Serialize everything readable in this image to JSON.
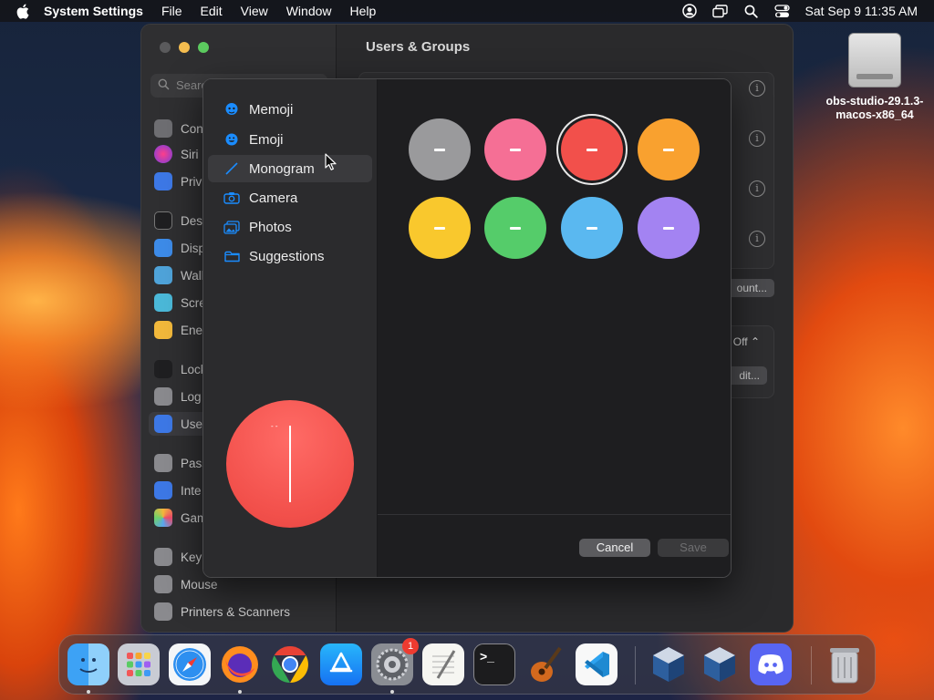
{
  "menubar": {
    "app_name": "System Settings",
    "menus": [
      "File",
      "Edit",
      "View",
      "Window",
      "Help"
    ],
    "clock": "Sat Sep 9  11:35 AM"
  },
  "desktop": {
    "icon_label_line1": "obs-studio-29.1.3-",
    "icon_label_line2": "macos-x86_64"
  },
  "settings": {
    "window_title": "Users & Groups",
    "search_placeholder": "Search",
    "sidebar_fragments": [
      "Con",
      "Siri",
      "Priv",
      "Des",
      "Disp",
      "Wall",
      "Scre",
      "Ene",
      "Lock",
      "Log",
      "Use",
      "Pass",
      "Inte",
      "Gam",
      "Keyb",
      "Mouse",
      "Printers & Scanners"
    ],
    "button_fragments": {
      "account": "ount...",
      "off": "Off",
      "edit": "dit..."
    },
    "info_icon_glyph": "i",
    "help_glyph": "?"
  },
  "picker": {
    "items": [
      {
        "label": "Memoji",
        "icon": "memoji-icon"
      },
      {
        "label": "Emoji",
        "icon": "emoji-icon"
      },
      {
        "label": "Monogram",
        "icon": "monogram-icon"
      },
      {
        "label": "Camera",
        "icon": "camera-icon"
      },
      {
        "label": "Photos",
        "icon": "photos-icon"
      },
      {
        "label": "Suggestions",
        "icon": "suggestions-icon"
      }
    ],
    "selected_item": "Monogram",
    "swatches": [
      {
        "color": "#9a9a9c",
        "selected": false
      },
      {
        "color": "#f56f95",
        "selected": false
      },
      {
        "color": "#f2504b",
        "selected": true
      },
      {
        "color": "#f9a12f",
        "selected": false
      },
      {
        "color": "#f9c82d",
        "selected": false
      },
      {
        "color": "#55cc6a",
        "selected": false
      },
      {
        "color": "#5ab8f0",
        "selected": false
      },
      {
        "color": "#a383f2",
        "selected": false
      }
    ],
    "preview_color": "#f2504b",
    "preview_dots": "- -",
    "cancel_label": "Cancel",
    "save_label": "Save"
  },
  "dock": {
    "apps": [
      "Finder",
      "Launchpad",
      "Safari",
      "Firefox",
      "Chrome",
      "App Store",
      "System Settings",
      "TextEdit",
      "Terminal",
      "GarageBand",
      "Visual Studio Code",
      "VirtualBox",
      "VirtualBox VM",
      "Discord",
      "Trash"
    ],
    "settings_badge": "1",
    "terminal_glyph": ">_"
  },
  "colors": {
    "accent_blue": "#1a8cff",
    "selected_swatch": "#f2504b"
  }
}
